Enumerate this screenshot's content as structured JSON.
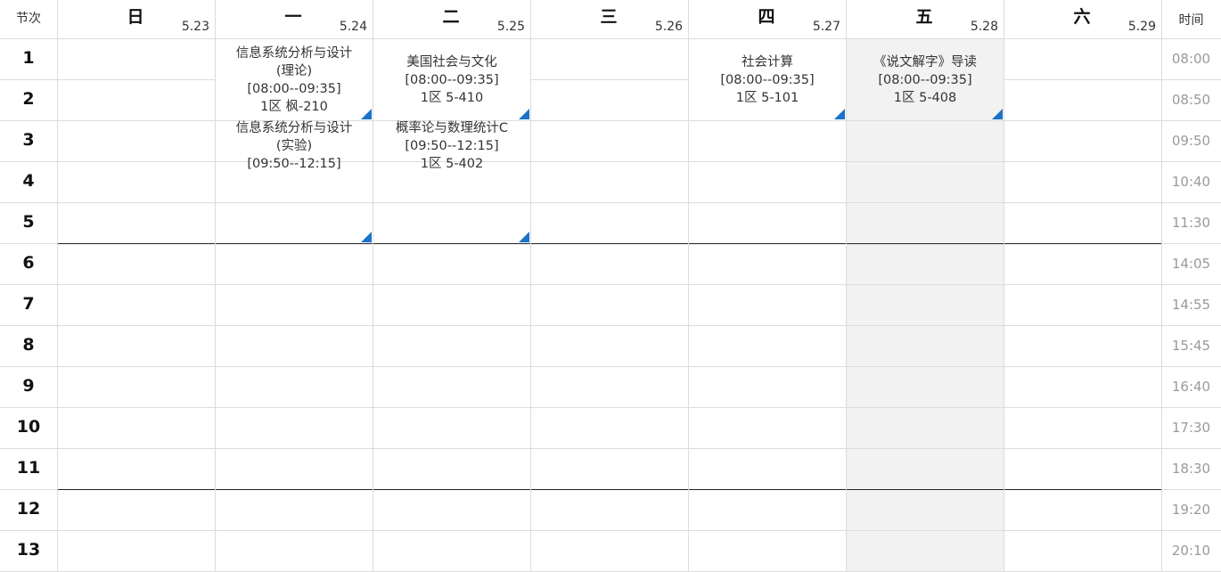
{
  "header": {
    "corner_label": "节次",
    "time_label": "时间",
    "days": [
      {
        "name": "日",
        "date": "5.23"
      },
      {
        "name": "一",
        "date": "5.24"
      },
      {
        "name": "二",
        "date": "5.25"
      },
      {
        "name": "三",
        "date": "5.26"
      },
      {
        "name": "四",
        "date": "5.27"
      },
      {
        "name": "五",
        "date": "5.28"
      },
      {
        "name": "六",
        "date": "5.29"
      }
    ],
    "highlighted_day_index": 5
  },
  "periods": [
    {
      "num": "1",
      "time": "08:00"
    },
    {
      "num": "2",
      "time": "08:50"
    },
    {
      "num": "3",
      "time": "09:50"
    },
    {
      "num": "4",
      "time": "10:40"
    },
    {
      "num": "5",
      "time": "11:30"
    },
    {
      "num": "6",
      "time": "14:05"
    },
    {
      "num": "7",
      "time": "14:55"
    },
    {
      "num": "8",
      "time": "15:45"
    },
    {
      "num": "9",
      "time": "16:40"
    },
    {
      "num": "10",
      "time": "17:30"
    },
    {
      "num": "11",
      "time": "18:30"
    },
    {
      "num": "12",
      "time": "19:20"
    },
    {
      "num": "13",
      "time": "20:10"
    }
  ],
  "courses": [
    {
      "day": 1,
      "start": 1,
      "end": 2,
      "title": "信息系统分析与设计",
      "subtitle": "(理论)",
      "time": "[08:00--09:35]",
      "room": "1区 枫-210"
    },
    {
      "day": 1,
      "start": 3,
      "end": 5,
      "title": "信息系统分析与设计",
      "subtitle": "(实验)",
      "time": "[09:50--12:15]",
      "room": ""
    },
    {
      "day": 2,
      "start": 1,
      "end": 2,
      "title": "美国社会与文化",
      "subtitle": "",
      "time": "[08:00--09:35]",
      "room": "1区 5-410"
    },
    {
      "day": 2,
      "start": 3,
      "end": 5,
      "title": "概率论与数理统计C",
      "subtitle": "",
      "time": "[09:50--12:15]",
      "room": "1区 5-402"
    },
    {
      "day": 4,
      "start": 1,
      "end": 2,
      "title": "社会计算",
      "subtitle": "",
      "time": "[08:00--09:35]",
      "room": "1区 5-101"
    },
    {
      "day": 5,
      "start": 1,
      "end": 2,
      "title": "《说文解字》导读",
      "subtitle": "",
      "time": "[08:00--09:35]",
      "room": "1区 5-408"
    }
  ],
  "colors": {
    "marker": "#1a73c8",
    "highlight_bg": "#f2f2f2",
    "grid_line": "#dcdcdc",
    "section_divider": "#222222",
    "time_text": "#9a9a9a"
  }
}
